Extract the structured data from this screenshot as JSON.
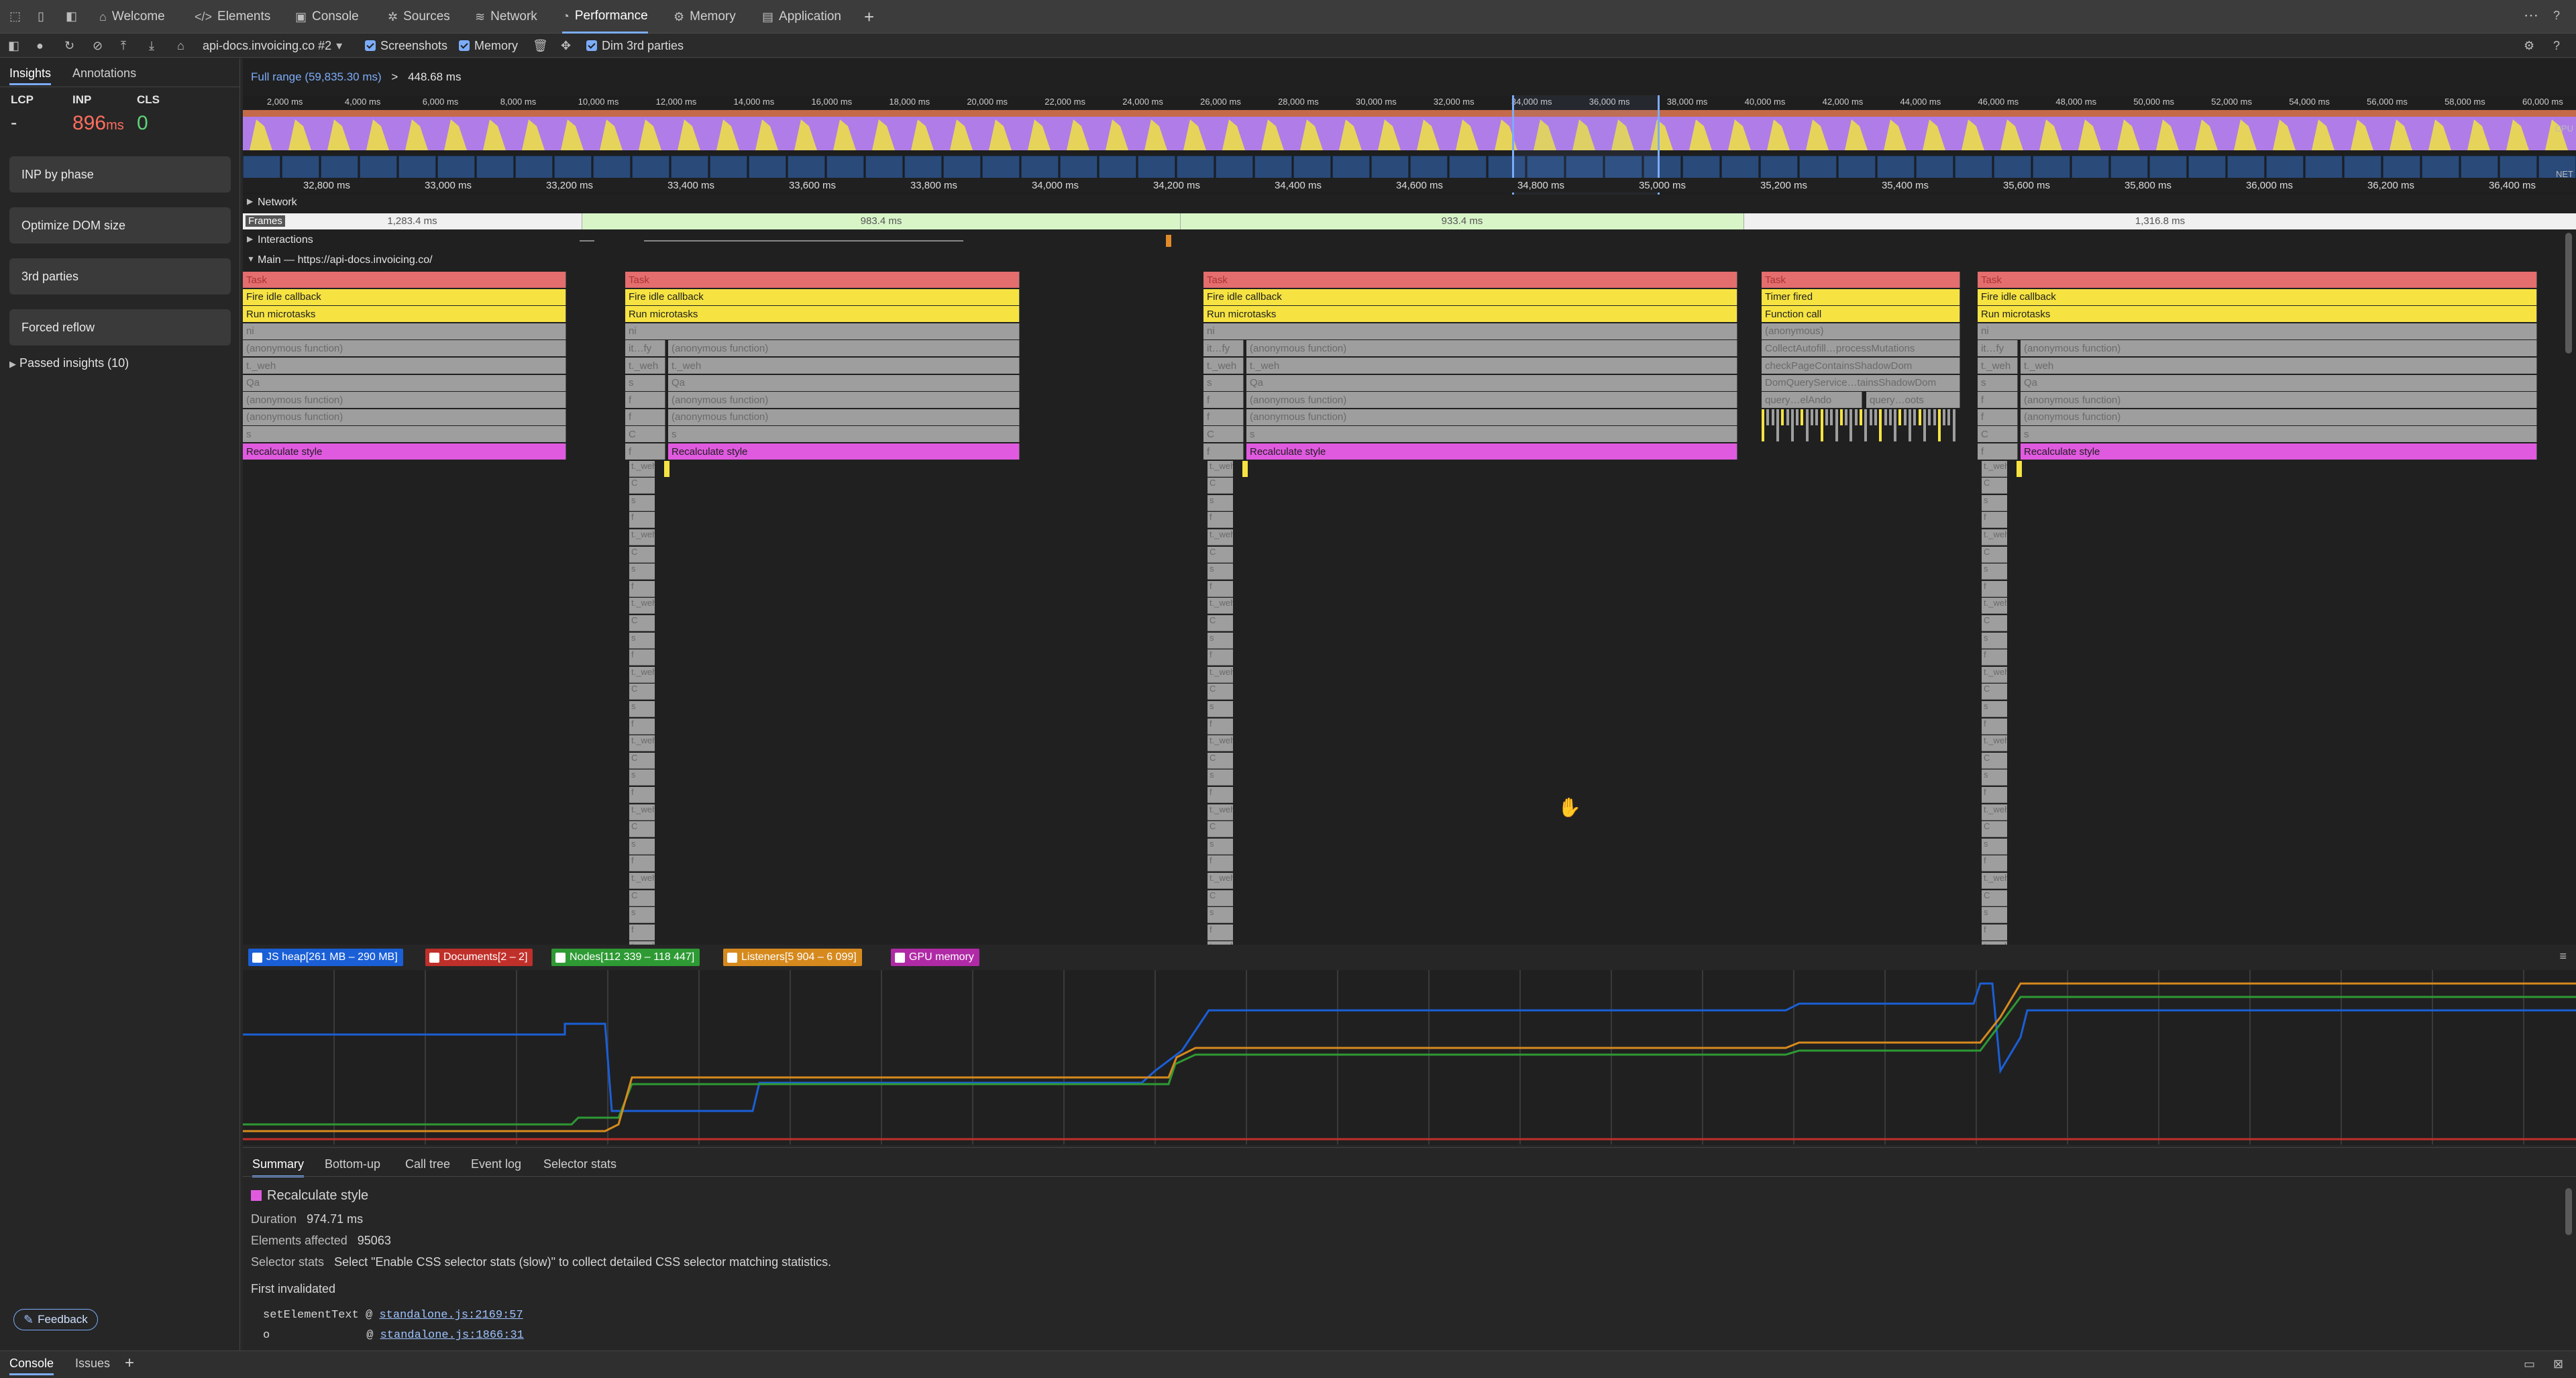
{
  "tabs": {
    "welcome": "Welcome",
    "elements": "Elements",
    "console": "Console",
    "sources": "Sources",
    "network": "Network",
    "performance": "Performance",
    "memory": "Memory",
    "application": "Application",
    "add": "+"
  },
  "toolbar": {
    "target": "api-docs.invoicing.co #2",
    "screenshots": "Screenshots",
    "memory": "Memory",
    "dim": "Dim 3rd parties"
  },
  "sidebar": {
    "tab_insights": "Insights",
    "tab_annotations": "Annotations",
    "lcp_label": "LCP",
    "inp_label": "INP",
    "cls_label": "CLS",
    "lcp_value": "-",
    "inp_value": "896",
    "inp_unit": "ms",
    "cls_value": "0",
    "cards": [
      "INP by phase",
      "Optimize DOM size",
      "3rd parties",
      "Forced reflow"
    ],
    "passed": "Passed insights (10)",
    "feedback": "Feedback"
  },
  "breadcrumb": {
    "full_range": "Full range (59,835.30 ms)",
    "sep": ">",
    "current": "448.68 ms"
  },
  "overview_ticks": [
    "2,000 ms",
    "4,000 ms",
    "6,000 ms",
    "8,000 ms",
    "10,000 ms",
    "12,000 ms",
    "14,000 ms",
    "16,000 ms",
    "18,000 ms",
    "20,000 ms",
    "22,000 ms",
    "24,000 ms",
    "26,000 ms",
    "28,000 ms",
    "30,000 ms",
    "32,000 ms",
    "34,000 ms",
    "36,000 ms",
    "38,000 ms",
    "40,000 ms",
    "42,000 ms",
    "44,000 ms",
    "46,000 ms",
    "48,000 ms",
    "50,000 ms",
    "52,000 ms",
    "54,000 ms",
    "56,000 ms",
    "58,000 ms",
    "60,000 ms"
  ],
  "cpu_label": "CPU",
  "net_label": "NET",
  "ruler_ticks": [
    "32,800 ms",
    "33,000 ms",
    "33,200 ms",
    "33,400 ms",
    "33,600 ms",
    "33,800 ms",
    "34,000 ms",
    "34,200 ms",
    "34,400 ms",
    "34,600 ms",
    "34,800 ms",
    "35,000 ms",
    "35,200 ms",
    "35,400 ms",
    "35,600 ms",
    "35,800 ms",
    "36,000 ms",
    "36,200 ms",
    "36,400 ms"
  ],
  "tracks": {
    "network": "Network",
    "frames": "Frames",
    "interactions": "Interactions",
    "main": "Main — https://api-docs.invoicing.co/"
  },
  "frames": [
    "1,283.4 ms",
    "983.4 ms",
    "933.4 ms",
    "1,316.8 ms"
  ],
  "flame": {
    "task": "Task",
    "fire_idle": "Fire idle callback",
    "run_micro": "Run microtasks",
    "recalc": "Recalculate style",
    "anon": "(anonymous function)",
    "timer": "Timer fired",
    "function_call": "Function call",
    "anon_short": "(anonymous)",
    "collect": "CollectAutofill…processMutations",
    "check": "checkPageContainsShadowDom",
    "dom": "DomQueryService…tainsShadowDom",
    "query1": "query…elAndo",
    "query2": "query…oots",
    "wh": "t._weh",
    "qa": "Qa",
    "ni": "ni",
    "fy": "it…fy",
    "s": "s",
    "c": "C",
    "f": "f"
  },
  "memory_legend": [
    {
      "label": "JS heap[261 MB – 290 MB]",
      "color": "#1a5fd6"
    },
    {
      "label": "Documents[2 – 2]",
      "color": "#c0302a"
    },
    {
      "label": "Nodes[112 339 – 118 447]",
      "color": "#2e9a34"
    },
    {
      "label": "Listeners[5 904 – 6 099]",
      "color": "#d68a1e"
    },
    {
      "label": "GPU memory",
      "color": "#b02aa6"
    }
  ],
  "bottom_tabs": [
    "Summary",
    "Bottom-up",
    "Call tree",
    "Event log",
    "Selector stats"
  ],
  "summary": {
    "title": "Recalculate style",
    "duration_label": "Duration",
    "duration_value": "974.71 ms",
    "elements_label": "Elements affected",
    "elements_value": "95063",
    "selector_label": "Selector stats",
    "selector_value": "Select \"Enable CSS selector stats (slow)\" to collect detailed CSS selector matching statistics.",
    "first_invalidated": "First invalidated",
    "stack": [
      {
        "fn": "setElementText",
        "at": "@",
        "link": "standalone.js:2169:57"
      },
      {
        "fn": "o",
        "at": "@",
        "link": "standalone.js:1866:31"
      }
    ]
  },
  "statusbar": {
    "console": "Console",
    "issues": "Issues"
  },
  "colors": {
    "accent": "#7cacf8",
    "idle": "#f6e342",
    "style": "#e05ae0",
    "task": "#9e9e9e"
  }
}
